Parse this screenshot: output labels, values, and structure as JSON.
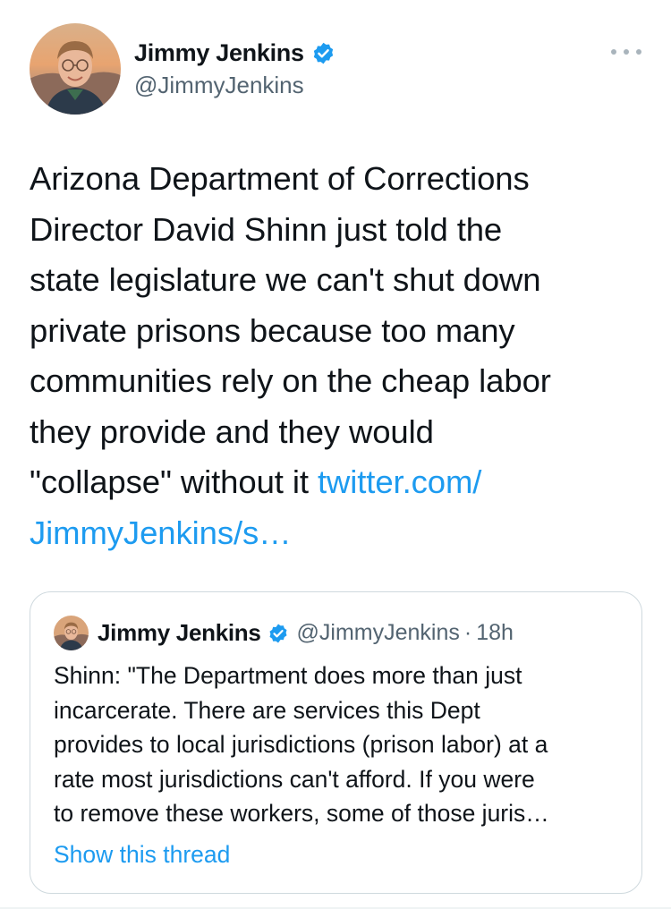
{
  "tweet": {
    "author_name": "Jimmy Jenkins",
    "author_handle": "@JimmyJenkins",
    "verified_icon": "verified-badge-icon",
    "more_icon": "more-options-icon",
    "text_lines": "Arizona Department of Corrections\nDirector David Shinn just told the\nstate legislature we can't shut down\nprivate prisons because too many\ncommunities rely on the cheap labor\nthey provide and they would\n\"collapse\" without it ",
    "link_text": "twitter.com/\nJimmyJenkins/s…"
  },
  "quote": {
    "author_name": "Jimmy Jenkins",
    "author_handle": "@JimmyJenkins",
    "separator": "·",
    "time": "18h",
    "text": "Shinn: \"The Department does more than just\nincarcerate. There are services this Dept\nprovides to local jurisdictions (prison labor) at a\nrate most jurisdictions can't afford. If you were\nto remove these workers, some of those juris…",
    "show_thread": "Show this thread"
  },
  "colors": {
    "link": "#1d9bf0",
    "secondary_text": "#536471",
    "border": "#cfd9de",
    "verified": "#1d9bf0"
  }
}
